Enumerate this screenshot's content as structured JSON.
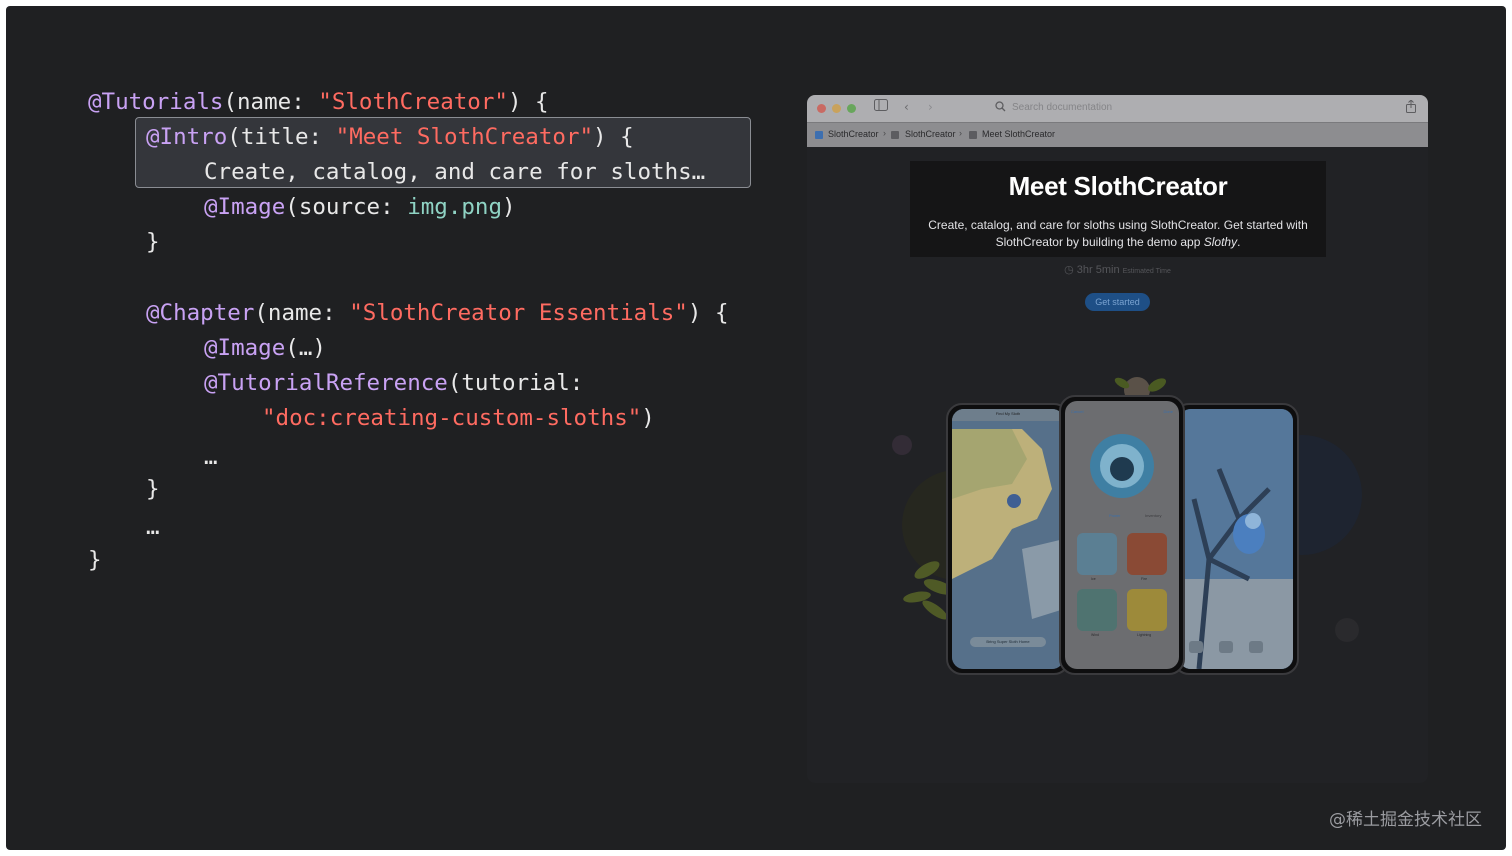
{
  "code": {
    "line1": {
      "attr": "@Tutorials",
      "p1": "(name: ",
      "str": "\"SlothCreator\"",
      "p2": ") {"
    },
    "line2": {
      "attr": "@Intro",
      "p1": "(title: ",
      "str": "\"Meet SlothCreator\"",
      "p2": ") {"
    },
    "line3": {
      "text": "Create, catalog, and care for sloths…"
    },
    "line4": {
      "attr": "@Image",
      "p1": "(source: ",
      "file": "img.png",
      "p2": ")"
    },
    "line5": {
      "text": "}"
    },
    "line6": {
      "attr": "@Chapter",
      "p1": "(name: ",
      "str": "\"SlothCreator Essentials\"",
      "p2": ") {"
    },
    "line7": {
      "attr": "@Image",
      "p1": "(…)"
    },
    "line8": {
      "attr": "@TutorialReference",
      "p1": "(tutorial:"
    },
    "line9": {
      "str": "\"doc:creating-custom-sloths\"",
      "p2": ")"
    },
    "line10": {
      "text": "…"
    },
    "line11": {
      "text": "}"
    },
    "line12": {
      "text": "…"
    },
    "line13": {
      "text": "}"
    }
  },
  "browser": {
    "search_placeholder": "Search documentation",
    "breadcrumbs": [
      "SlothCreator",
      "SlothCreator",
      "Meet SlothCreator"
    ],
    "hero_title": "Meet SlothCreator",
    "hero_desc_main": "Create, catalog, and care for sloths using SlothCreator. Get started with SlothCreator by building the demo app ",
    "hero_desc_app": "Slothy",
    "hero_desc_end": ".",
    "time_value": "3hr 5min",
    "time_label": "Estimated Time",
    "get_started": "Get started"
  },
  "phones": {
    "left_header": "Find My Sloth",
    "left_footer": "Bring Super Sloth Home",
    "middle_tabs": [
      "Power",
      "Inventory"
    ],
    "middle_cancel": "Cancel",
    "middle_done": "Done",
    "power_labels": [
      "Ice",
      "Fire",
      "Wind",
      "Lightning"
    ]
  },
  "colors": {
    "background": "#1f2022",
    "attribute": "#c9a2f4",
    "string": "#ff6b61",
    "filename": "#8fd3c4",
    "text": "#e8e8e8"
  },
  "watermark": "@稀土掘金技术社区"
}
